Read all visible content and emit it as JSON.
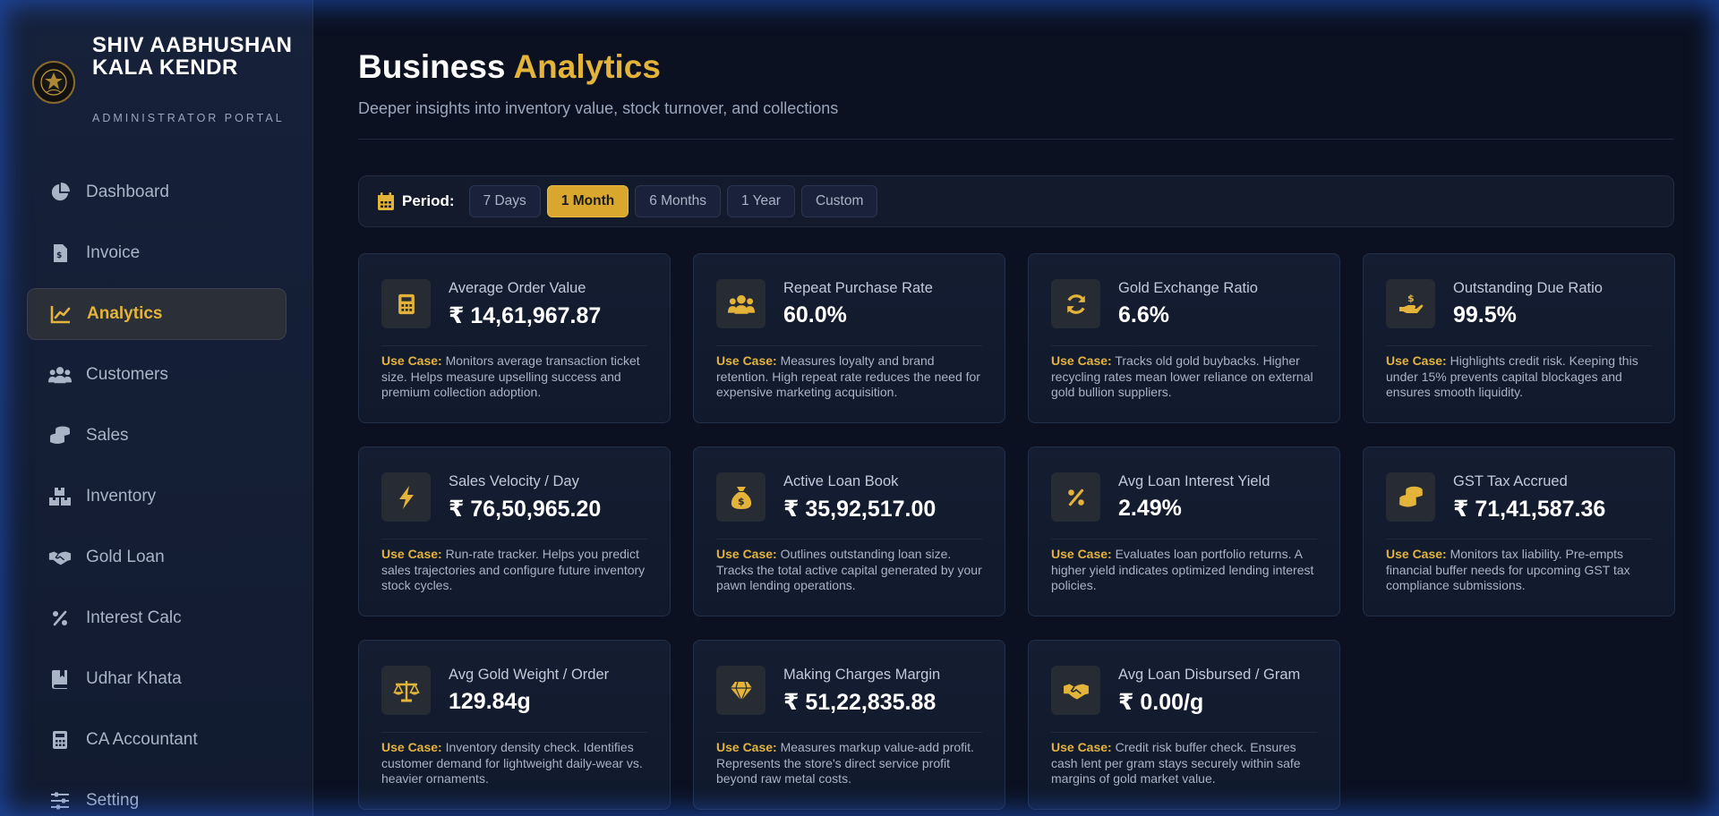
{
  "brand": {
    "name": "SHIV AABHUSHAN KALA KENDR",
    "subtitle": "ADMINISTRATOR PORTAL"
  },
  "nav": {
    "items": [
      {
        "label": "Dashboard",
        "icon": "pie-chart-icon",
        "active": false
      },
      {
        "label": "Invoice",
        "icon": "invoice-icon",
        "active": false
      },
      {
        "label": "Analytics",
        "icon": "line-chart-icon",
        "active": true
      },
      {
        "label": "Customers",
        "icon": "users-icon",
        "active": false
      },
      {
        "label": "Sales",
        "icon": "coins-icon",
        "active": false
      },
      {
        "label": "Inventory",
        "icon": "boxes-icon",
        "active": false
      },
      {
        "label": "Gold Loan",
        "icon": "handshake-icon",
        "active": false
      },
      {
        "label": "Interest Calc",
        "icon": "percent-icon",
        "active": false
      },
      {
        "label": "Udhar Khata",
        "icon": "book-icon",
        "active": false
      },
      {
        "label": "CA Accountant",
        "icon": "calculator-icon",
        "active": false
      },
      {
        "label": "Setting",
        "icon": "sliders-icon",
        "active": false
      }
    ]
  },
  "header": {
    "title_main": "Business",
    "title_accent": "Analytics",
    "subtitle": "Deeper insights into inventory value, stock turnover, and collections"
  },
  "period": {
    "label": "Period:",
    "options": [
      "7 Days",
      "1 Month",
      "6 Months",
      "1 Year",
      "Custom"
    ],
    "selected": "1 Month"
  },
  "use_case_prefix": "Use Case:",
  "metrics": [
    {
      "label": "Average Order Value",
      "value": "₹ 14,61,967.87",
      "icon": "calculator-icon",
      "desc": "Monitors average transaction ticket size. Helps measure upselling success and premium collection adoption."
    },
    {
      "label": "Repeat Purchase Rate",
      "value": "60.0%",
      "icon": "users-icon",
      "desc": "Measures loyalty and brand retention. High repeat rate reduces the need for expensive marketing acquisition."
    },
    {
      "label": "Gold Exchange Ratio",
      "value": "6.6%",
      "icon": "refresh-icon",
      "desc": "Tracks old gold buybacks. Higher recycling rates mean lower reliance on external gold bullion suppliers."
    },
    {
      "label": "Outstanding Due Ratio",
      "value": "99.5%",
      "icon": "hand-money-icon",
      "desc": "Highlights credit risk. Keeping this under 15% prevents capital blockages and ensures smooth liquidity."
    },
    {
      "label": "Sales Velocity / Day",
      "value": "₹ 76,50,965.20",
      "icon": "bolt-icon",
      "desc": "Run-rate tracker. Helps you predict sales trajectories and configure future inventory stock cycles."
    },
    {
      "label": "Active Loan Book",
      "value": "₹ 35,92,517.00",
      "icon": "money-bag-icon",
      "desc": "Outlines outstanding loan size. Tracks the total active capital generated by your pawn lending operations."
    },
    {
      "label": "Avg Loan Interest Yield",
      "value": "2.49%",
      "icon": "percent-icon",
      "desc": "Evaluates loan portfolio returns. A higher yield indicates optimized lending interest policies."
    },
    {
      "label": "GST Tax Accrued",
      "value": "₹ 71,41,587.36",
      "icon": "coins-icon",
      "desc": "Monitors tax liability. Pre-empts financial buffer needs for upcoming GST tax compliance submissions."
    },
    {
      "label": "Avg Gold Weight / Order",
      "value": "129.84g",
      "icon": "scale-icon",
      "desc": "Inventory density check. Identifies customer demand for lightweight daily-wear vs. heavier ornaments."
    },
    {
      "label": "Making Charges Margin",
      "value": "₹ 51,22,835.88",
      "icon": "gem-icon",
      "desc": "Measures markup value-add profit. Represents the store's direct service profit beyond raw metal costs."
    },
    {
      "label": "Avg Loan Disbursed / Gram",
      "value": "₹ 0.00/g",
      "icon": "handshake-icon",
      "desc": "Credit risk buffer check. Ensures cash lent per gram stays securely within safe margins of gold market value."
    }
  ],
  "colors": {
    "accent": "#e3b33a",
    "background": "#0b1120",
    "sidebar": "#16213a",
    "card": "#141d31"
  }
}
